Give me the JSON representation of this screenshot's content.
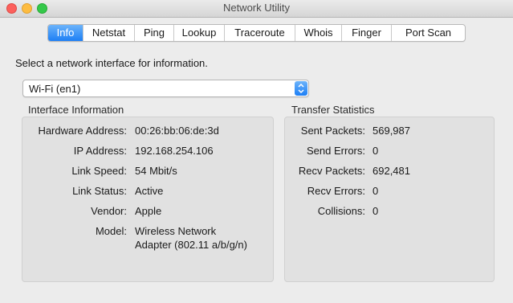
{
  "window": {
    "title": "Network Utility"
  },
  "tabs": [
    {
      "label": "Info",
      "selected": true
    },
    {
      "label": "Netstat"
    },
    {
      "label": "Ping"
    },
    {
      "label": "Lookup"
    },
    {
      "label": "Traceroute"
    },
    {
      "label": "Whois"
    },
    {
      "label": "Finger"
    },
    {
      "label": "Port Scan"
    }
  ],
  "prompt": "Select a network interface for information.",
  "interface_select": {
    "value": "Wi-Fi (en1)",
    "icon": "up-down-chevron-icon"
  },
  "interface_info": {
    "title": "Interface Information",
    "rows": [
      {
        "label": "Hardware Address:",
        "value": "00:26:bb:06:de:3d"
      },
      {
        "label": "IP Address:",
        "value": "192.168.254.106"
      },
      {
        "label": "Link Speed:",
        "value": "54 Mbit/s"
      },
      {
        "label": "Link Status:",
        "value": "Active"
      },
      {
        "label": "Vendor:",
        "value": "Apple"
      },
      {
        "label": "Model:",
        "value": "Wireless Network",
        "value2": "Adapter (802.11 a/b/g/n)"
      }
    ]
  },
  "transfer_stats": {
    "title": "Transfer Statistics",
    "rows": [
      {
        "label": "Sent Packets:",
        "value": "569,987"
      },
      {
        "label": "Send Errors:",
        "value": "0"
      },
      {
        "label": "Recv Packets:",
        "value": "692,481"
      },
      {
        "label": "Recv Errors:",
        "value": "0"
      },
      {
        "label": "Collisions:",
        "value": "0"
      }
    ]
  },
  "colors": {
    "accent": "#1d7ff5",
    "close": "#fc605c",
    "minimize": "#fdbc40",
    "maximize": "#34c84a"
  }
}
